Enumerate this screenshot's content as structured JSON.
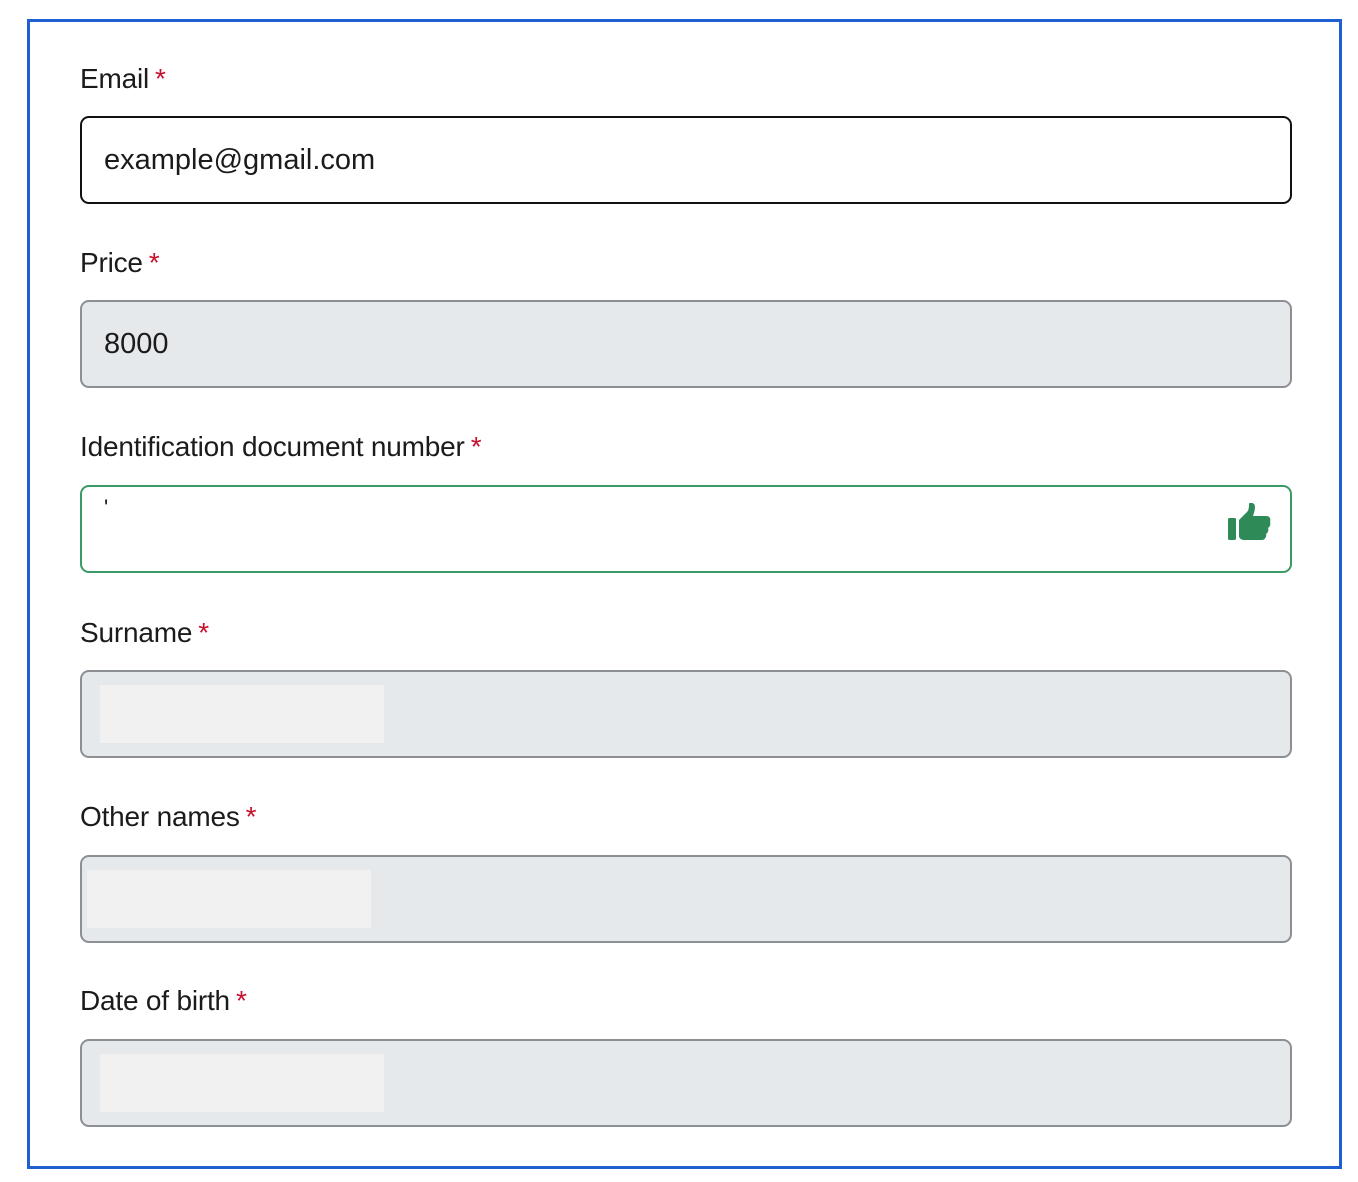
{
  "form": {
    "required_marker": "*",
    "email": {
      "label": "Email",
      "value": "example@gmail.com"
    },
    "price": {
      "label": "Price",
      "value": "8000"
    },
    "id_number": {
      "label": "Identification document number",
      "value": "'",
      "status_icon": "thumbs-up-icon",
      "status_color": "#2e8b57"
    },
    "surname": {
      "label": "Surname",
      "value": ""
    },
    "other_names": {
      "label": "Other names",
      "value": ""
    },
    "date_of_birth": {
      "label": "Date of birth",
      "value": ""
    }
  },
  "colors": {
    "frame_border": "#1f5fd1",
    "required": "#c8102e",
    "valid_border": "#3b9a66",
    "disabled_bg": "#e6e9ec"
  }
}
